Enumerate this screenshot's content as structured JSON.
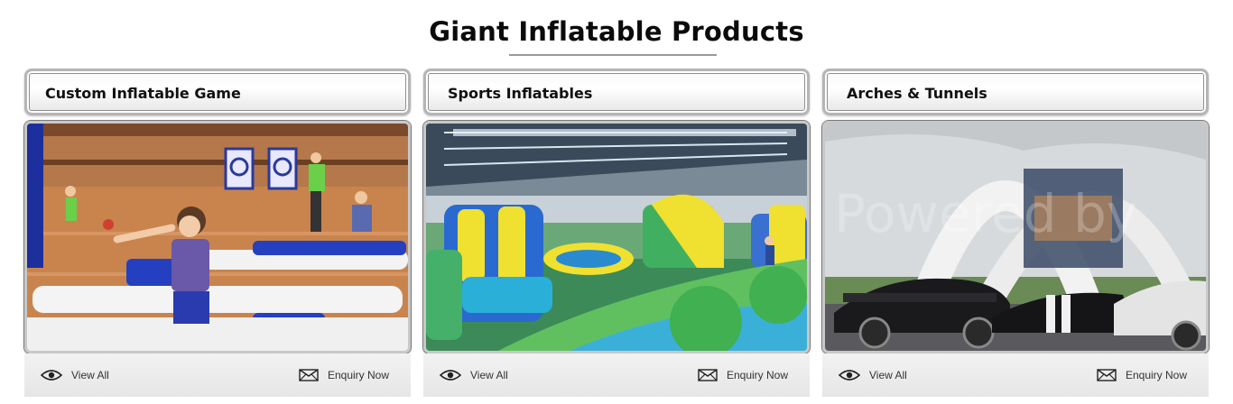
{
  "section": {
    "title": "Giant Inflatable Products"
  },
  "cards": [
    {
      "title": "Custom Inflatable Game",
      "image_subject": "children playing inflatable game in gym",
      "view_all": "View All",
      "enquiry": "Enquiry Now"
    },
    {
      "title": "Sports Inflatables",
      "image_subject": "inflatable obstacle park in warehouse",
      "view_all": "View All",
      "enquiry": "Enquiry Now"
    },
    {
      "title": "Arches & Tunnels",
      "image_subject": "inflatable arch over race cars",
      "view_all": "View All",
      "enquiry": "Enquiry Now",
      "watermark": "Powered by"
    }
  ],
  "icons": {
    "view": "eye-icon",
    "enquiry": "envelope-icon"
  },
  "colors": {
    "header_border": "#b5b5b5",
    "footer_bg": "#e9e9e9",
    "title_text": "#0b0b0b"
  }
}
